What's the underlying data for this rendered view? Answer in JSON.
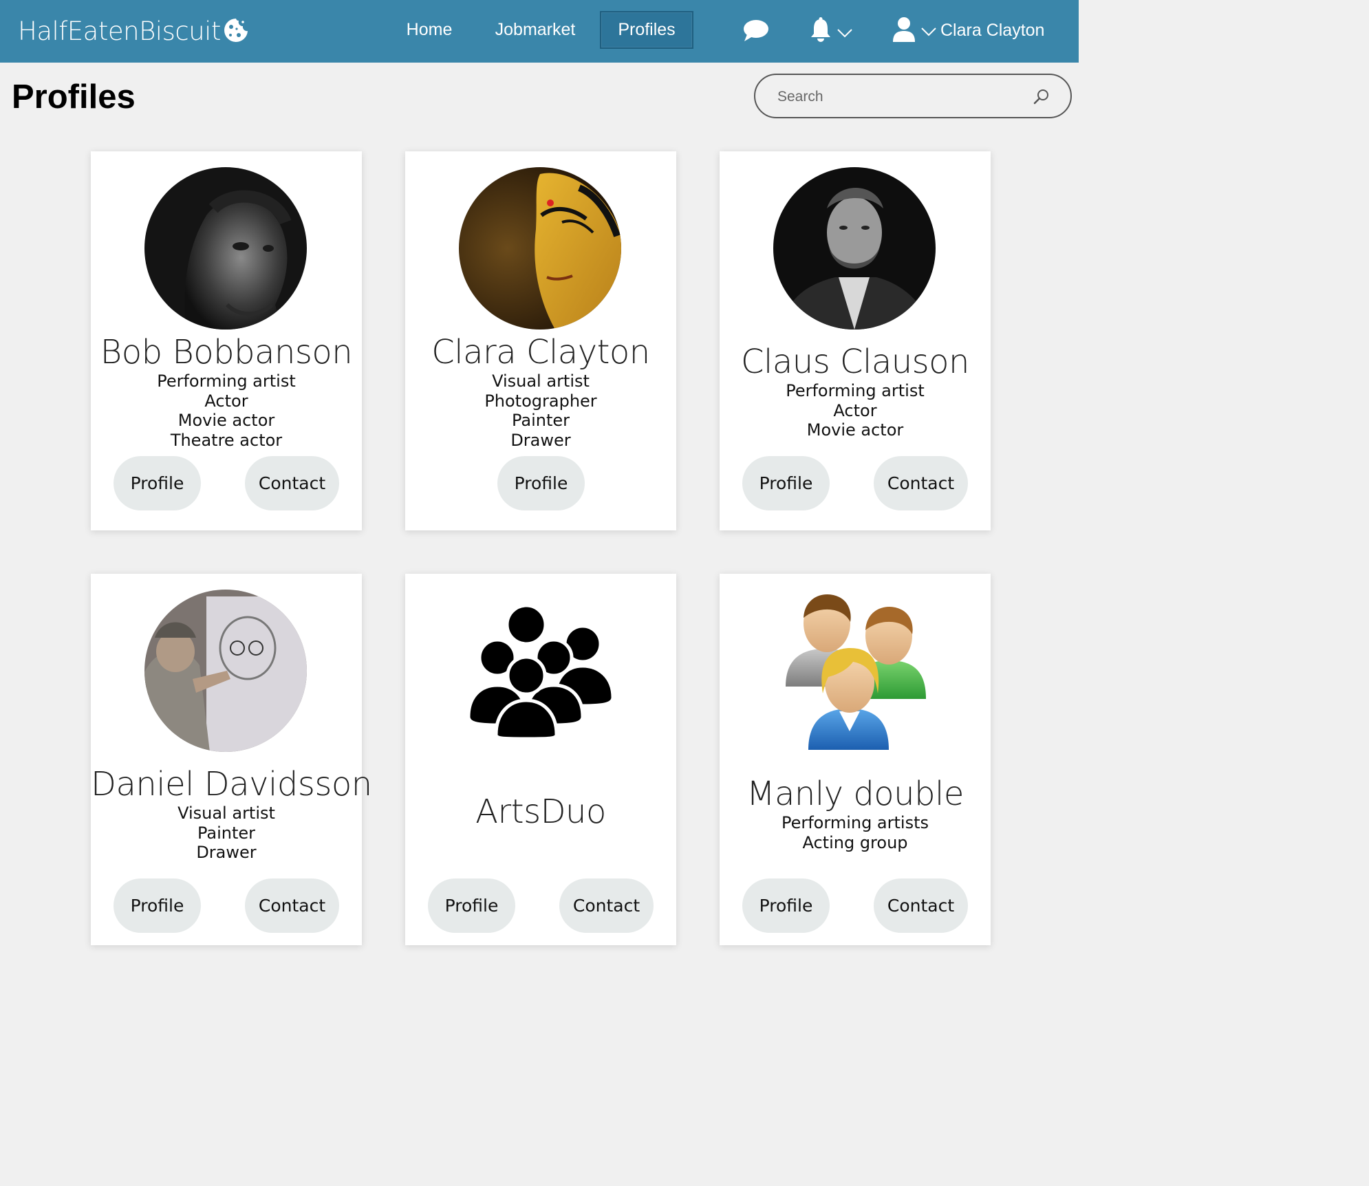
{
  "app": {
    "brand": "HalfEatenBiscuit",
    "nav": [
      "Home",
      "Jobmarket",
      "Profiles"
    ],
    "active_nav": "Profiles",
    "user_name": "Clara Clayton"
  },
  "header": {
    "title": "Profiles",
    "search_placeholder": "Search"
  },
  "buttons": {
    "profile": "Profile",
    "contact": "Contact"
  },
  "profiles": [
    {
      "name": "Bob Bobbanson",
      "tags": [
        "Performing artist",
        "Actor",
        "Movie actor",
        "Theatre actor"
      ],
      "has_contact": true
    },
    {
      "name": "Clara Clayton",
      "tags": [
        "Visual artist",
        "Photographer",
        "Painter",
        "Drawer"
      ],
      "has_contact": false
    },
    {
      "name": "Claus Clauson",
      "tags": [
        "Performing artist",
        "Actor",
        "Movie actor"
      ],
      "has_contact": true
    },
    {
      "name": "Daniel Davidsson",
      "tags": [
        "Visual artist",
        "Painter",
        "Drawer"
      ],
      "has_contact": true
    },
    {
      "name": "ArtsDuo",
      "tags": [],
      "has_contact": true
    },
    {
      "name": "Manly double",
      "tags": [
        "Performing artists",
        "Acting group"
      ],
      "has_contact": true
    }
  ],
  "icons": {
    "brand": "cookie-icon",
    "messages": "chat-bubble-icon",
    "notifications": "bell-icon",
    "user": "user-icon",
    "search": "search-icon"
  }
}
